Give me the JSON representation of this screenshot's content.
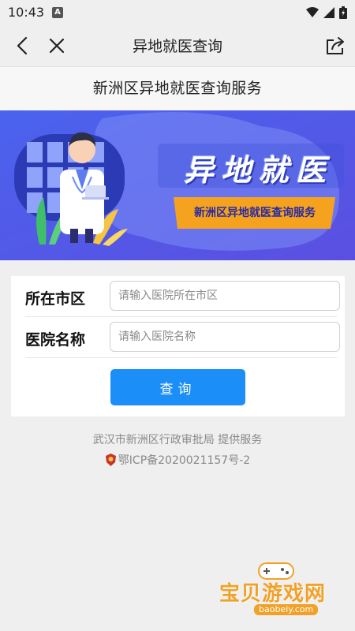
{
  "status_bar": {
    "time": "10:43",
    "notification_glyph": "A"
  },
  "nav": {
    "title": "异地就医查询"
  },
  "page_header": {
    "title": "新洲区异地就医查询服务"
  },
  "banner": {
    "headline": "异 地 就 医",
    "subtitle": "新洲区异地就医查询服务"
  },
  "form": {
    "city_label": "所在市区",
    "city_placeholder": "请输入医院所在市区",
    "city_value": "",
    "hospital_label": "医院名称",
    "hospital_placeholder": "请输入医院名称",
    "hospital_value": "",
    "query_label": "查询"
  },
  "footer": {
    "provider": "武汉市新洲区行政审批局  提供服务",
    "icp": "鄂ICP备2020021157号-2"
  },
  "watermark": {
    "text": "宝贝游戏网",
    "url": "baobeiy.com"
  },
  "colors": {
    "primary_button": "#1b8ef8",
    "banner_bg": "#4d5fe8",
    "banner_tag": "#f5a31f",
    "page_bg": "#efefef"
  }
}
